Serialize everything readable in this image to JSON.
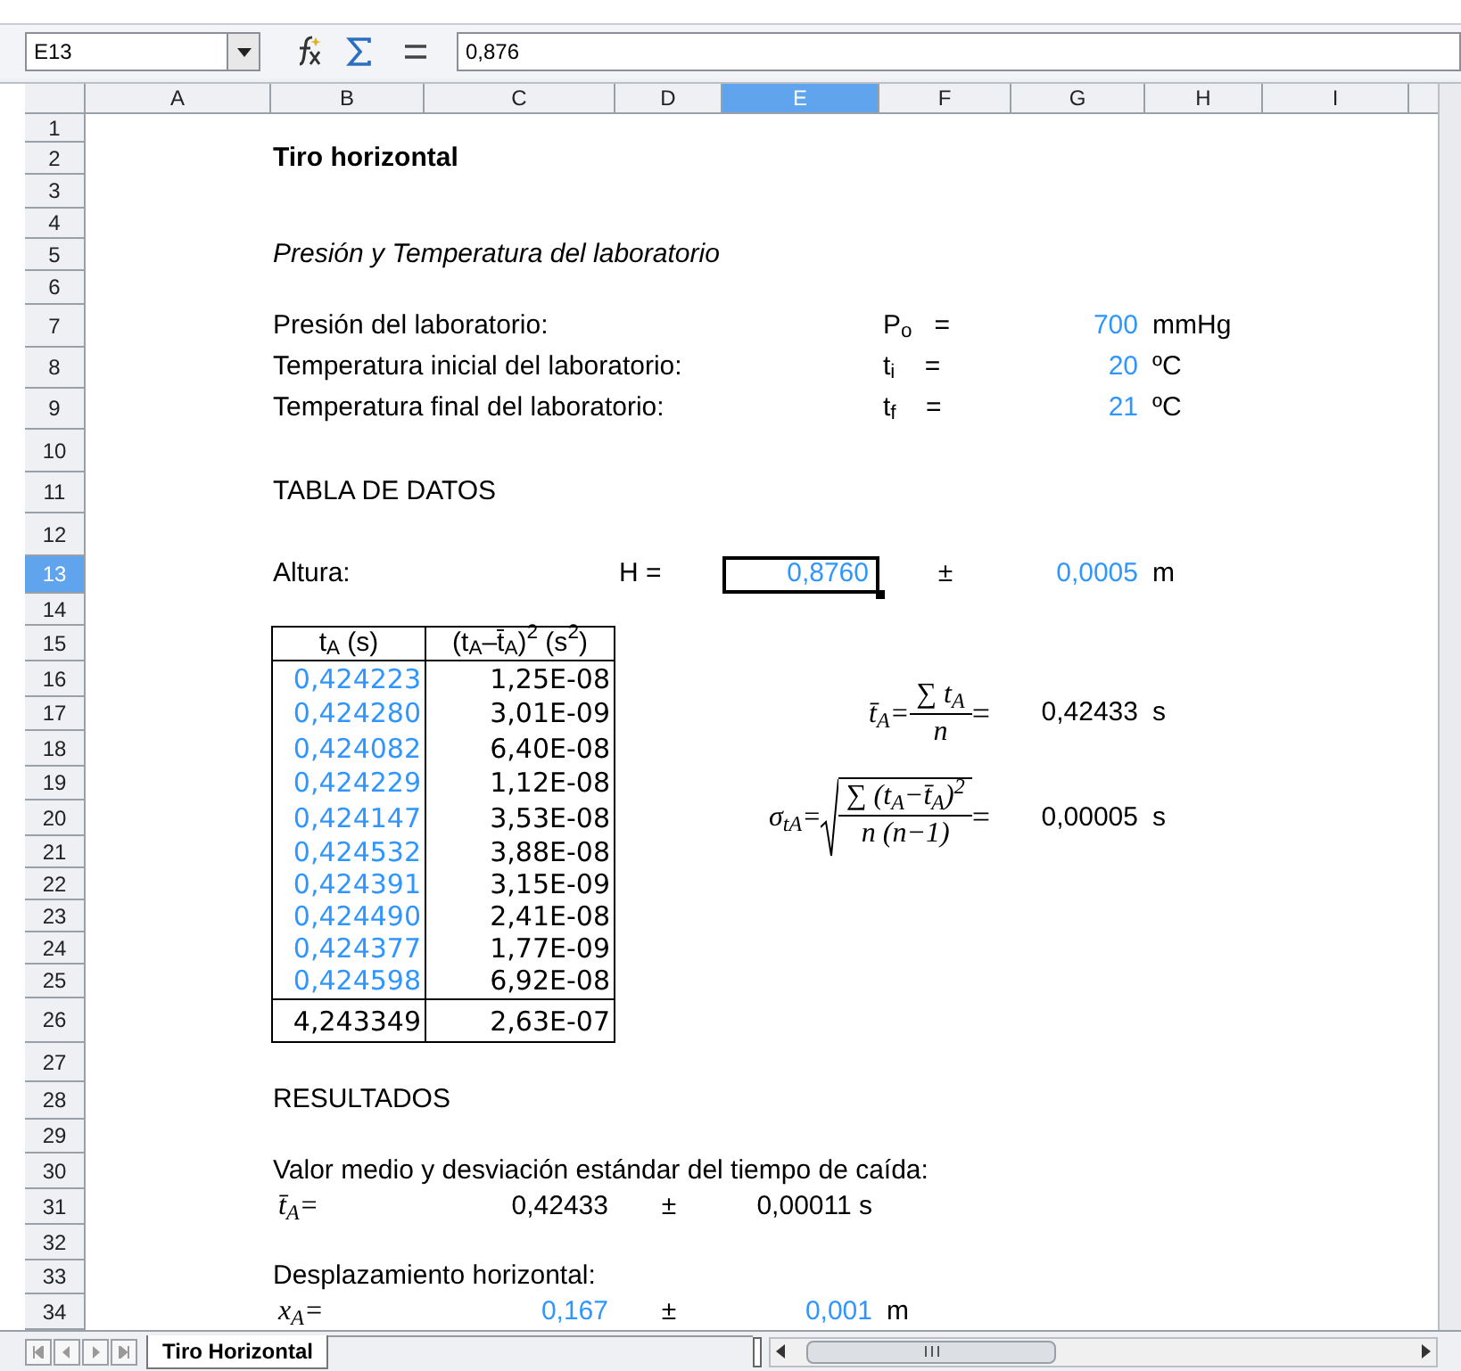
{
  "name_box": "E13",
  "formula": "0,876",
  "columns": [
    {
      "label": "A",
      "selected": false
    },
    {
      "label": "B",
      "selected": false
    },
    {
      "label": "C",
      "selected": false
    },
    {
      "label": "D",
      "selected": false
    },
    {
      "label": "E",
      "selected": true
    },
    {
      "label": "F",
      "selected": false
    },
    {
      "label": "G",
      "selected": false
    },
    {
      "label": "H",
      "selected": false
    },
    {
      "label": "I",
      "selected": false
    }
  ],
  "rows": [
    {
      "label": "1",
      "selected": false
    },
    {
      "label": "2",
      "selected": false,
      "cells": {
        "B": {
          "kind": "title",
          "text": "Tiro horizontal"
        }
      }
    },
    {
      "label": "3",
      "selected": false
    },
    {
      "label": "4",
      "selected": false
    },
    {
      "label": "5",
      "selected": false,
      "cells": {
        "B": {
          "kind": "subtitle",
          "text": "Presión y Temperatura del laboratorio"
        }
      }
    },
    {
      "label": "6",
      "selected": false
    },
    {
      "label": "7",
      "selected": false,
      "cells": {
        "B": {
          "kind": "text",
          "text": "Presión del laboratorio:"
        },
        "F": {
          "kind": "symbol_left",
          "text": "P$_{o}$   ="
        },
        "G": {
          "kind": "input",
          "text": "700"
        },
        "H": {
          "kind": "unit",
          "text": "mmHg"
        }
      }
    },
    {
      "label": "8",
      "selected": false,
      "cells": {
        "B": {
          "kind": "text",
          "text": "Temperatura inicial del laboratorio:"
        },
        "F": {
          "kind": "symbol_left",
          "text": "t$_{i}$    ="
        },
        "G": {
          "kind": "input",
          "text": "20"
        },
        "H": {
          "kind": "unit",
          "text": "ºC"
        }
      }
    },
    {
      "label": "9",
      "selected": false,
      "cells": {
        "B": {
          "kind": "text",
          "text": "Temperatura final del laboratorio:"
        },
        "F": {
          "kind": "symbol_left",
          "text": "t$_{f}$    ="
        },
        "G": {
          "kind": "input",
          "text": "21"
        },
        "H": {
          "kind": "unit",
          "text": "ºC"
        }
      }
    },
    {
      "label": "10",
      "selected": false
    },
    {
      "label": "11",
      "selected": false,
      "cells": {
        "B": {
          "kind": "heading",
          "text": "TABLA DE DATOS"
        }
      }
    },
    {
      "label": "12",
      "selected": false
    },
    {
      "label": "13",
      "selected": true,
      "cells": {
        "B": {
          "kind": "text",
          "text": "Altura:"
        },
        "D": {
          "kind": "symbol_left",
          "text": "H ="
        },
        "E": {
          "kind": "input",
          "text": "0,8760"
        },
        "F": {
          "kind": "symbol",
          "text": "±"
        },
        "G": {
          "kind": "input",
          "text": "0,0005"
        },
        "H": {
          "kind": "unit",
          "text": "m"
        }
      }
    },
    {
      "label": "14",
      "selected": false
    },
    {
      "label": "15",
      "selected": false,
      "cells": {
        "B": {
          "kind": "table_header",
          "text": "t$_{A}$ (s)"
        },
        "C": {
          "kind": "table_header",
          "text": "(t$_{A}$–t̄$_{A}$)$^{2}$ (s$^{2}$)"
        }
      }
    },
    {
      "label": "16",
      "selected": false,
      "cells": {
        "B": {
          "kind": "table_input",
          "text": "0,424223"
        },
        "C": {
          "kind": "table_number",
          "text": "1,25E-08"
        }
      }
    },
    {
      "label": "17",
      "selected": false,
      "cells": {
        "B": {
          "kind": "table_input",
          "text": "0,424280"
        },
        "C": {
          "kind": "table_number",
          "text": "3,01E-09"
        },
        "D": {
          "kind": "formula",
          "lhs": "t̄$_{A}$=",
          "numerator": "∑ t$_{A}$",
          "denominator": "n",
          "tail": "=",
          "root": false
        },
        "G": {
          "kind": "number",
          "text": "0,42433"
        },
        "H": {
          "kind": "unit",
          "text": "s"
        }
      }
    },
    {
      "label": "18",
      "selected": false,
      "cells": {
        "B": {
          "kind": "table_input",
          "text": "0,424082"
        },
        "C": {
          "kind": "table_number",
          "text": "6,40E-08"
        }
      }
    },
    {
      "label": "19",
      "selected": false,
      "cells": {
        "B": {
          "kind": "table_input",
          "text": "0,424229"
        },
        "C": {
          "kind": "table_number",
          "text": "1,12E-08"
        }
      }
    },
    {
      "label": "20",
      "selected": false,
      "cells": {
        "B": {
          "kind": "table_input",
          "text": "0,424147"
        },
        "C": {
          "kind": "table_number",
          "text": "3,53E-08"
        },
        "D": {
          "kind": "formula",
          "lhs": "σ$_{tA}$=",
          "numerator": "∑ (t$_{A}$−t̄$_{A}$)$^{2}$",
          "denominator": "n (n−1)",
          "tail": "=",
          "root": true
        },
        "G": {
          "kind": "number",
          "text": "0,00005"
        },
        "H": {
          "kind": "unit",
          "text": "s"
        }
      }
    },
    {
      "label": "21",
      "selected": false,
      "cells": {
        "B": {
          "kind": "table_input",
          "text": "0,424532"
        },
        "C": {
          "kind": "table_number",
          "text": "3,88E-08"
        }
      }
    },
    {
      "label": "22",
      "selected": false,
      "cells": {
        "B": {
          "kind": "table_input",
          "text": "0,424391"
        },
        "C": {
          "kind": "table_number",
          "text": "3,15E-09"
        }
      }
    },
    {
      "label": "23",
      "selected": false,
      "cells": {
        "B": {
          "kind": "table_input",
          "text": "0,424490"
        },
        "C": {
          "kind": "table_number",
          "text": "2,41E-08"
        }
      }
    },
    {
      "label": "24",
      "selected": false,
      "cells": {
        "B": {
          "kind": "table_input",
          "text": "0,424377"
        },
        "C": {
          "kind": "table_number",
          "text": "1,77E-09"
        }
      }
    },
    {
      "label": "25",
      "selected": false,
      "cells": {
        "B": {
          "kind": "table_input",
          "text": "0,424598"
        },
        "C": {
          "kind": "table_number",
          "text": "6,92E-08"
        }
      }
    },
    {
      "label": "26",
      "selected": false,
      "cells": {
        "B": {
          "kind": "table_total",
          "text": "4,243349"
        },
        "C": {
          "kind": "table_total",
          "text": "2,63E-07"
        }
      }
    },
    {
      "label": "27",
      "selected": false
    },
    {
      "label": "28",
      "selected": false,
      "cells": {
        "B": {
          "kind": "heading",
          "text": "RESULTADOS"
        }
      }
    },
    {
      "label": "29",
      "selected": false
    },
    {
      "label": "30",
      "selected": false,
      "cells": {
        "B": {
          "kind": "text",
          "text": "Valor medio y desviación estándar del tiempo de caída:"
        }
      }
    },
    {
      "label": "31",
      "selected": false,
      "cells": {
        "B": {
          "kind": "math",
          "text": "t̄$_{A}$="
        },
        "C": {
          "kind": "number",
          "text": "0,42433"
        },
        "D": {
          "kind": "symbol",
          "text": "±"
        },
        "E": {
          "kind": "number",
          "text": "0,00011 s"
        }
      }
    },
    {
      "label": "32",
      "selected": false
    },
    {
      "label": "33",
      "selected": false,
      "cells": {
        "B": {
          "kind": "text",
          "text": "Desplazamiento horizontal:"
        }
      }
    },
    {
      "label": "34",
      "selected": false,
      "cells": {
        "B": {
          "kind": "math",
          "text": "x$_{A}$="
        },
        "C": {
          "kind": "input",
          "text": "0,167"
        },
        "D": {
          "kind": "symbol",
          "text": "±"
        },
        "E": {
          "kind": "input",
          "text": "0,001"
        },
        "F": {
          "kind": "unit",
          "text": "m"
        }
      }
    }
  ],
  "sheet_tabs": [
    {
      "label": "Tiro Horizontal",
      "selected": true
    }
  ]
}
